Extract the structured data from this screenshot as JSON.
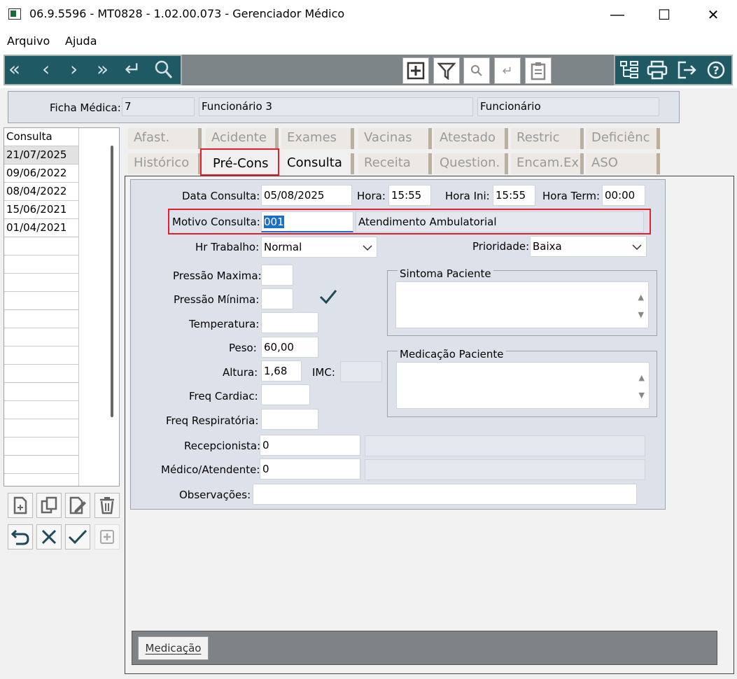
{
  "window": {
    "title": "06.9.5596 - MT0828 - 1.02.00.073 - Gerenciador Médico",
    "minimize": "—",
    "maximize": "☐",
    "close": "✕"
  },
  "menu": [
    "Arquivo",
    "Ajuda"
  ],
  "header": {
    "ficha_label": "Ficha Médica:",
    "ficha_value": "7",
    "name": "Funcionário 3",
    "type": "Funcionário"
  },
  "left_list": {
    "header": "Consulta",
    "items": [
      "21/07/2025",
      "09/06/2022",
      "08/04/2022",
      "15/06/2021",
      "01/04/2021"
    ]
  },
  "tabs_row1": [
    "Afast.",
    "Acidente",
    "Exames",
    "Vacinas",
    "Atestado",
    "Restric",
    "Deficiênc"
  ],
  "tabs_row2": [
    "Histórico",
    "Pré-Cons",
    "Consulta",
    "Receita",
    "Question.",
    "Encam.Ex",
    "ASO"
  ],
  "form": {
    "data_consulta_label": "Data Consulta:",
    "data_consulta": "05/08/2025",
    "hora_label": "Hora:",
    "hora": "15:55",
    "hora_ini_label": "Hora Ini:",
    "hora_ini": "15:55",
    "hora_term_label": "Hora Term:",
    "hora_term": "00:00",
    "motivo_label": "Motivo Consulta:",
    "motivo_code": "001",
    "motivo_desc": "Atendimento Ambulatorial",
    "hr_trabalho_label": "Hr Trabalho:",
    "hr_trabalho": "Normal",
    "prioridade_label": "Prioridade:",
    "prioridade": "Baixa",
    "pressao_max_label": "Pressão Maxima:",
    "pressao_min_label": "Pressão  Mínima:",
    "temperatura_label": "Temperatura:",
    "peso_label": "Peso:",
    "peso": "60,00",
    "altura_label": "Altura:",
    "altura": "1,68",
    "imc_label": "IMC:",
    "freq_cardiac_label": "Freq Cardiac:",
    "freq_resp_label": "Freq Respiratória:",
    "recepcionista_label": "Recepcionista:",
    "recepcionista": "0",
    "medico_label": "Médico/Atendente:",
    "medico": "0",
    "observacoes_label": "Observações:",
    "sintoma_title": "Sintoma Paciente",
    "medicacao_title": "Medicação Paciente"
  },
  "bottom": {
    "medicacao_button": "Medicação"
  }
}
